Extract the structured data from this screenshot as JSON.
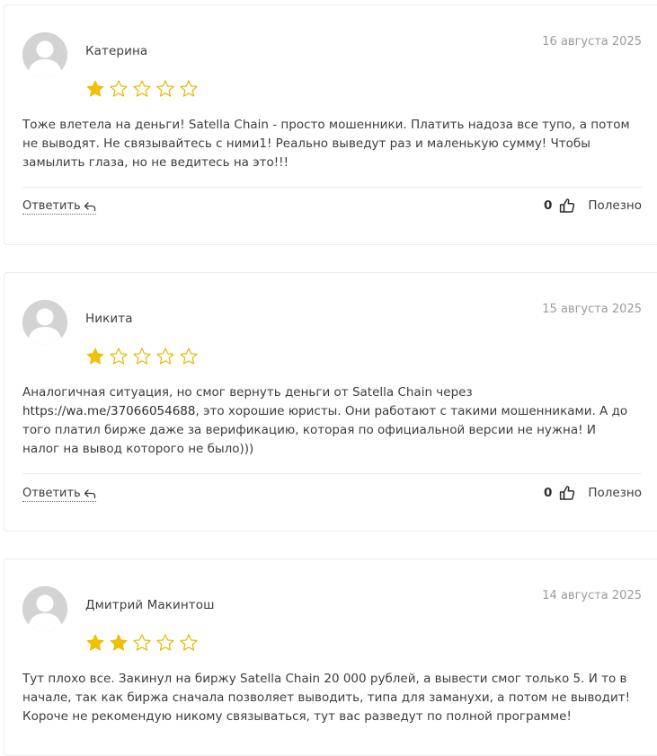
{
  "reviews": [
    {
      "author": "Катерина",
      "date": "16 августа 2025",
      "rating": 1,
      "max_rating": 5,
      "text_lines": [
        "Тоже влетела на деньги! Satella Chain - просто мошенники. Платить надоза все тупо, а потом",
        "не выводят. Не связывайтесь с ними1! Реально выведут раз и маленькую сумму! Чтобы",
        "замылить глаза, но не ведитесь на это!!!"
      ],
      "reply_label": "Ответить",
      "helpful_count": "0",
      "helpful_label": "Полезно"
    },
    {
      "author": "Никита",
      "date": "15 августа 2025",
      "rating": 1,
      "max_rating": 5,
      "text_line1": "Аналогичная ситуация, но смог вернуть деньги от Satella Chain через",
      "link": "https://wa.me/37066054688",
      "text_line2_rest": ", это хорошие юристы. Они работают с такими мошенниками. А до",
      "text_line3": "того платил бирже даже за верификацию, которая по официальной версии не нужна! И",
      "text_line4": "налог на вывод которого не было)))",
      "reply_label": "Ответить",
      "helpful_count": "0",
      "helpful_label": "Полезно"
    },
    {
      "author": "Дмитрий Макинтош",
      "date": "14 августа 2025",
      "rating": 2,
      "max_rating": 5,
      "text_lines": [
        "Тут плохо все. Закинул на биржу Satella Chain 20 000 рублей, а вывести смог только 5. И то в",
        "начале, так как биржа сначала позволяет выводить, типа для заманухи, а потом не выводит!",
        "Короче не рекомендую никому связываться, тут вас разведут по полной программе!"
      ]
    }
  ],
  "colors": {
    "star_fill": "#f2c200",
    "star_outline": "#e8b800",
    "avatar_bg": "#d3d3d3",
    "divider": "#ececec",
    "date": "#9a9a9a"
  },
  "icons": {
    "avatar": "user-avatar-icon",
    "star_filled": "star-filled-icon",
    "star_empty": "star-outline-icon",
    "reply": "reply-arrow-icon",
    "thumb": "thumbs-up-icon"
  }
}
